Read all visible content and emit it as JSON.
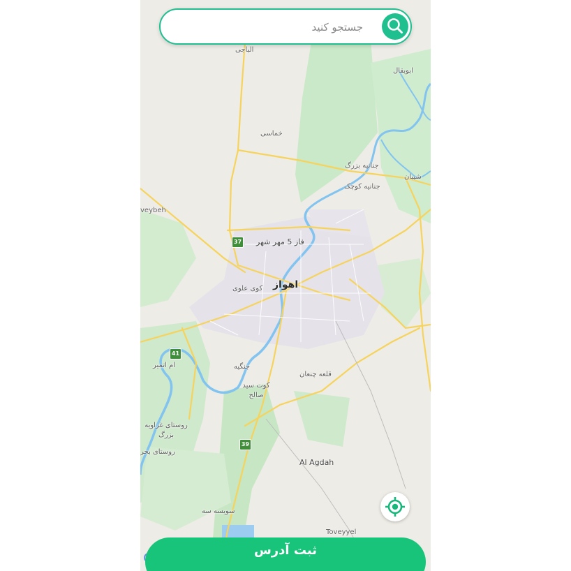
{
  "search": {
    "placeholder": "جستجو کنید",
    "icon": "search-icon"
  },
  "map": {
    "labels": {
      "albaji": "الباجی",
      "abubaqal": "ابوبقال",
      "khamasi": "خماسی",
      "jenaniye_bozorg": "جنانیه بزرگ",
      "jenaniye_kuchek": "جنانیه کوچک",
      "sheyban": "شیبان",
      "veybeh": "veybeh",
      "faz5": "فاز 5 مهر شهر",
      "ahvaz": "اهواز",
      "kuy_alavi": "کوی علوی",
      "om_otmir": "ام اتمیر",
      "jangiyeh": "جنگیه",
      "kut_seyed_saleh": "کوت سید صالح",
      "qaleh_chanan": "قلعه چنعان",
      "rusta_ghazaviyeh": "روستای غزاویه بزرگ",
      "rusta_bahr": "روستای بحر",
      "al_agdah": "Al Agdah",
      "sovayseh": "سویسه سه",
      "toveyyel": "Toveyyel"
    },
    "road_shields": {
      "r37": "37",
      "r41": "41",
      "r39": "39"
    },
    "colors": {
      "land": "#eeece6",
      "green": "#c7e8c8",
      "water": "#7fc3ee",
      "road": "#f6d45e",
      "urban": "#e6e3ea"
    }
  },
  "locate": {
    "icon": "crosshair-locate-icon"
  },
  "submit": {
    "label": "ثبت آدرس"
  },
  "theme": {
    "accent": "#1fbf90",
    "submit_green": "#17c47a"
  }
}
